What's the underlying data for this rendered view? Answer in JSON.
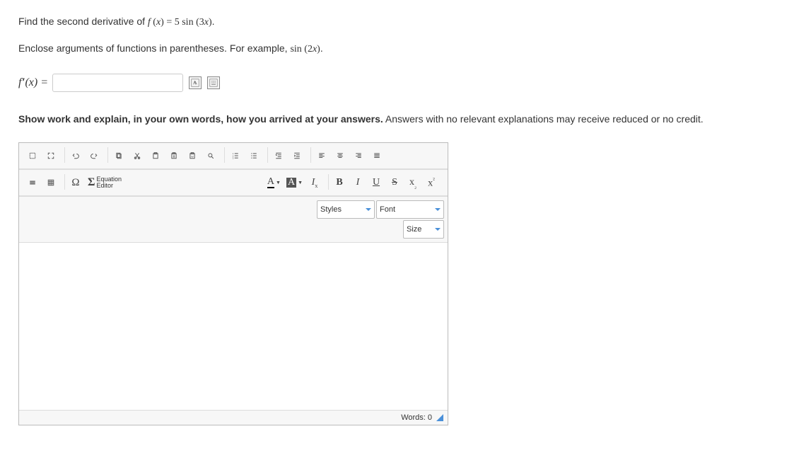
{
  "question": {
    "prefix": "Find the second derivative of ",
    "func": "f (x) = 5 sin (3x)",
    "suffix": "."
  },
  "hint": {
    "prefix": "Enclose arguments of functions in parentheses. For example, ",
    "example": "sin (2x)",
    "suffix": "."
  },
  "answer": {
    "label_f": "f",
    "label_primes": "′′",
    "label_paren": " (x) = ",
    "value": ""
  },
  "instructions": {
    "bold": "Show work and explain, in your own words, how you arrived at your answers.",
    "rest": " Answers with no relevant explanations may receive reduced or no credit."
  },
  "editor": {
    "equation_label_1": "Equation",
    "equation_label_2": "Editor",
    "combos": {
      "styles": "Styles",
      "font": "Font",
      "size": "Size"
    },
    "footer_words": "Words: 0"
  }
}
